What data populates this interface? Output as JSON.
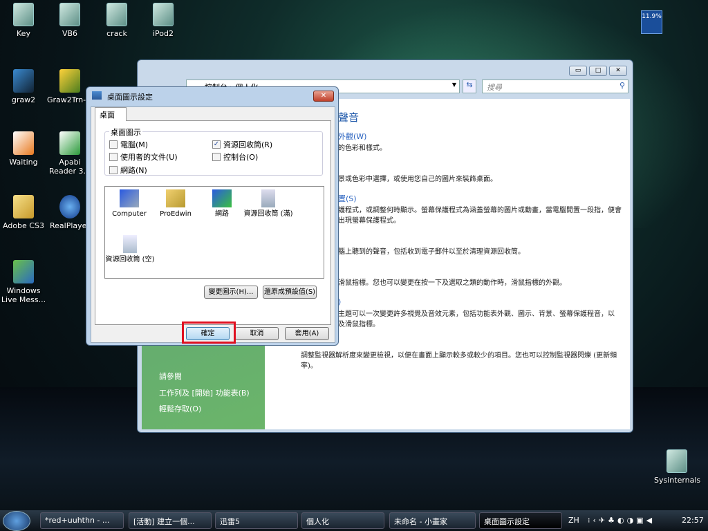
{
  "desktop": {
    "icons": [
      "Key",
      "VB6",
      "crack",
      "iPod2",
      "graw2",
      "Graw2Trn-...",
      "Waiting",
      "Apabi Reader 3...",
      "Adobe CS3",
      "RealPlayer",
      "Windows Live Mess...",
      "Sysinternals"
    ],
    "cpu_gadget": "11.9%"
  },
  "control_panel": {
    "address": "控制台 › 個人化",
    "search_placeholder": "搜尋",
    "heading": "聲音",
    "items": [
      {
        "link": "外觀(W)",
        "desc": "的色彩和樣式。"
      },
      {
        "link": "",
        "desc": "景或色彩中選擇，或使用您自己的圖片來裝飾桌面。"
      },
      {
        "link": "置(S)",
        "desc": "護程式，或調整何時顯示。螢幕保護程式為涵蓋螢幕的圖片或動畫，當電腦閒置一段指，便會出現螢幕保護程式。"
      },
      {
        "link": "",
        "desc": "腦上聽到的聲音，包括收到電子郵件以至於清理資源回收筒。"
      },
      {
        "link": "",
        "desc": "滑鼠指標。您也可以變更在按一下及選取之類的動作時，滑鼠指標的外觀。"
      },
      {
        "link": ")",
        "desc": "主題可以一次變更許多視覺及音效元素，包括功能表外觀、圖示、背景、螢幕保護程音，以及滑鼠指標。"
      },
      {
        "link": "",
        "desc": "調整監視器解析度來變更檢視，以便在畫面上顯示較多或較少的項目。您也可以控制監視器閃爍 (更新頻率)。"
      }
    ],
    "see_also": "請參閱",
    "see_also_links": [
      "工作列及 [開始] 功能表(B)",
      "輕鬆存取(O)"
    ]
  },
  "dialog": {
    "title": "桌面圖示設定",
    "tab": "桌面",
    "group_label": "桌面圖示",
    "checkboxes": [
      {
        "label": "電腦(M)",
        "checked": false
      },
      {
        "label": "資源回收筒(R)",
        "checked": true
      },
      {
        "label": "使用者的文件(U)",
        "checked": false
      },
      {
        "label": "控制台(O)",
        "checked": false
      },
      {
        "label": "網路(N)",
        "checked": false
      }
    ],
    "icons": [
      "Computer",
      "ProEdwin",
      "網路",
      "資源回收筒 (滿)",
      "資源回收筒 (空)"
    ],
    "change_icon": "變更圖示(H)...",
    "restore_default": "還原成預設值(S)",
    "ok": "確定",
    "cancel": "取消",
    "apply": "套用(A)",
    "highlight_color": "#e01020"
  },
  "taskbar": {
    "items": [
      "*red+uuhthn - ...",
      "[活動] 建立一個...",
      "迅雷5",
      "個人化",
      "未命名 - 小畫家",
      "桌面圖示設定"
    ],
    "lang": "ZH",
    "clock": "22:57"
  }
}
